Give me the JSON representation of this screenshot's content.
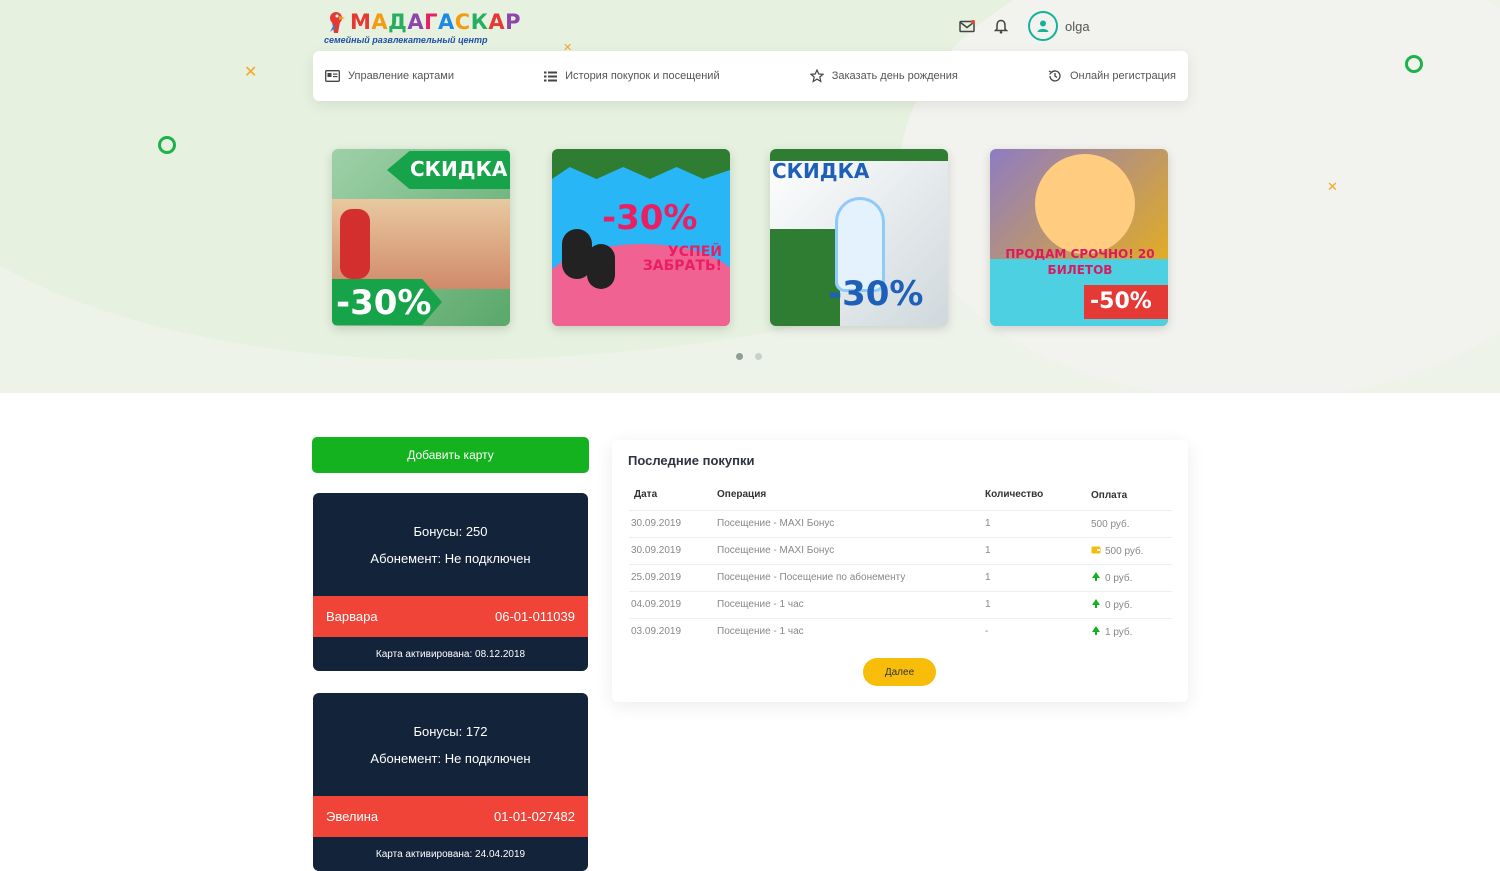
{
  "brand": {
    "name": "МАДАГАСКАР",
    "tagline": "семейный развлекательный центр",
    "letter_colors": [
      "#e53935",
      "#f39c12",
      "#27ae60",
      "#8e44ad",
      "#e91e63",
      "#1e88e5",
      "#f39c12",
      "#27ae60",
      "#e53935",
      "#8e44ad"
    ]
  },
  "header": {
    "icons": [
      "mail-icon",
      "bell-icon",
      "user-icon"
    ],
    "username": "olga"
  },
  "nav": [
    {
      "label": "Управление картами",
      "icon": "id-card-icon"
    },
    {
      "label": "История покупок и посещений",
      "icon": "list-icon"
    },
    {
      "label": "Заказать день рождения",
      "icon": "star-icon"
    },
    {
      "label": "Онлайн регистрация",
      "icon": "clock-icon"
    }
  ],
  "banners": [
    {
      "text_top": "СКИДКА",
      "text_bottom": "-30%"
    },
    {
      "text_top": "-30%",
      "text_bottom": "УСПЕЙ ЗАБРАТЬ!"
    },
    {
      "text_top": "СКИДКА",
      "text_bottom": "-30%"
    },
    {
      "text_top": "ПРОДАМ СРОЧНО! 20 БИЛЕТОВ",
      "text_bottom": "-50%"
    }
  ],
  "carousel": {
    "pages": 2,
    "active": 1
  },
  "add_card_label": "Добавить карту",
  "cards": [
    {
      "bonus": "Бонусы: 250",
      "subscription": "Абонемент: Не подключен",
      "holder": "Варвара",
      "number": "06-01-011039",
      "activated": "Карта активирована: 08.12.2018"
    },
    {
      "bonus": "Бонусы: 172",
      "subscription": "Абонемент: Не подключен",
      "holder": "Эвелина",
      "number": "01-01-027482",
      "activated": "Карта активирована: 24.04.2019"
    }
  ],
  "purchases": {
    "title": "Последние покупки",
    "columns": [
      "Дата",
      "Операция",
      "Количество",
      "Оплата"
    ],
    "rows": [
      {
        "date": "30.09.2019",
        "op": "Посещение - MAXI Бонус",
        "qty": "1",
        "pay": "500 руб.",
        "pay_icon": "none"
      },
      {
        "date": "30.09.2019",
        "op": "Посещение - MAXI Бонус",
        "qty": "1",
        "pay": "500 руб.",
        "pay_icon": "wallet-icon"
      },
      {
        "date": "25.09.2019",
        "op": "Посещение - Посещение по абонементу",
        "qty": "1",
        "pay": "0 руб.",
        "pay_icon": "tree-icon"
      },
      {
        "date": "04.09.2019",
        "op": "Посещение - 1 час",
        "qty": "1",
        "pay": "0 руб.",
        "pay_icon": "tree-icon"
      },
      {
        "date": "03.09.2019",
        "op": "Посещение - 1 час",
        "qty": "-",
        "pay": "1 руб.",
        "pay_icon": "tree-icon"
      }
    ],
    "next_label": "Далее"
  },
  "colors": {
    "green": "#15b21f",
    "card_dark": "#13233a",
    "card_red": "#f04438",
    "yellow": "#f7bd0a",
    "accent_teal": "#13b39a"
  }
}
